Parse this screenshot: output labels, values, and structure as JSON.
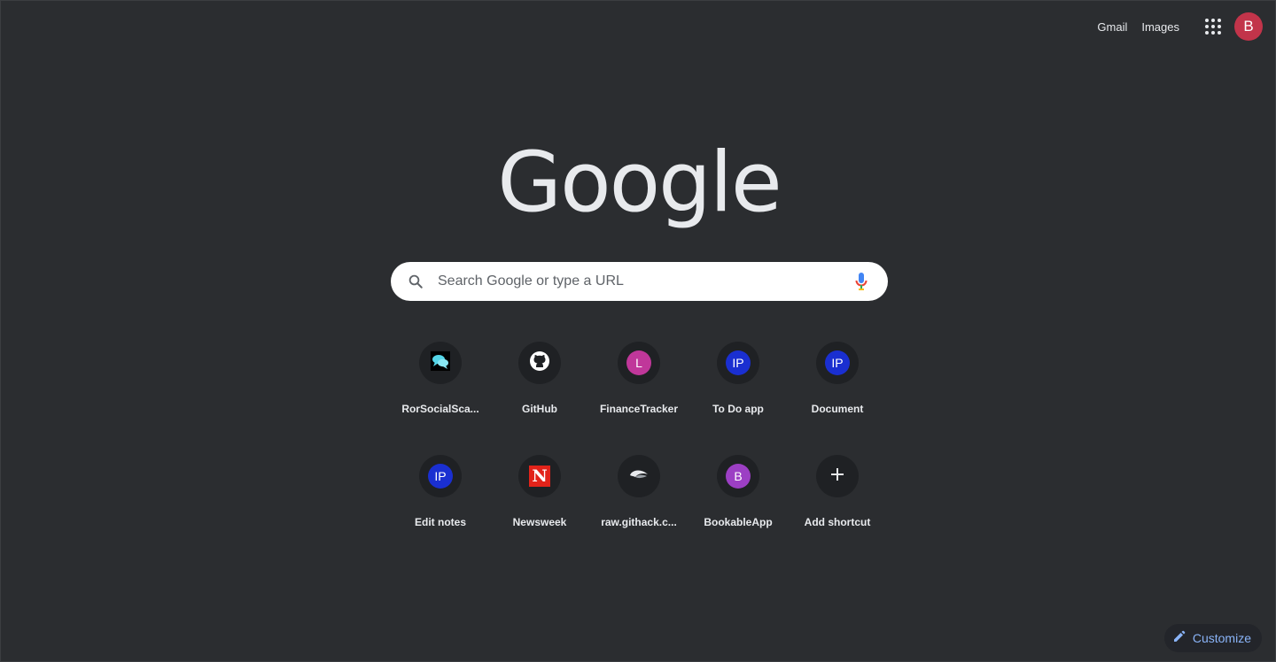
{
  "topbar": {
    "gmail": "Gmail",
    "images": "Images",
    "avatar_letter": "B",
    "avatar_color": "#c2344a"
  },
  "logo": {
    "text": "Google"
  },
  "search": {
    "placeholder": "Search Google or type a URL",
    "value": ""
  },
  "shortcuts": [
    {
      "title": "RorSocialSca...",
      "icon": "chat-bubbles-icon"
    },
    {
      "title": "GitHub",
      "icon": "github-icon"
    },
    {
      "title": "FinanceTracker",
      "icon": "letter",
      "letter": "L",
      "color": "#c0379a"
    },
    {
      "title": "To Do app",
      "icon": "letter",
      "letter": "IP",
      "color": "#1a2fd1"
    },
    {
      "title": "Document",
      "icon": "letter",
      "letter": "IP",
      "color": "#1a2fd1"
    },
    {
      "title": "Edit notes",
      "icon": "letter",
      "letter": "IP",
      "color": "#1a2fd1"
    },
    {
      "title": "Newsweek",
      "icon": "newsweek-icon",
      "letter": "N",
      "color": "#e2231a"
    },
    {
      "title": "raw.githack.c...",
      "icon": "githack-icon"
    },
    {
      "title": "BookableApp",
      "icon": "letter",
      "letter": "B",
      "color": "#9c3fc4"
    },
    {
      "title": "Add shortcut",
      "icon": "plus-icon"
    }
  ],
  "customize": {
    "label": "Customize",
    "color": "#8ab4f8"
  }
}
